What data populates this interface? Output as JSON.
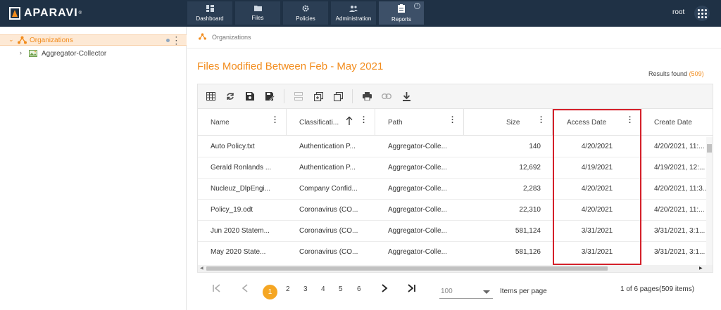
{
  "app": {
    "logo_text": "APARAVI",
    "logo_reg": "®",
    "user": "root"
  },
  "nav": {
    "tabs": [
      {
        "label": "Dashboard",
        "icon": "dashboard-icon"
      },
      {
        "label": "Files",
        "icon": "folder-icon"
      },
      {
        "label": "Policies",
        "icon": "gear-icon"
      },
      {
        "label": "Administration",
        "icon": "users-icon"
      },
      {
        "label": "Reports",
        "icon": "clipboard-icon",
        "active": true
      }
    ],
    "info_glyph": "i"
  },
  "sidebar": {
    "items": [
      {
        "label": "Organizations",
        "selected": true,
        "icon": "organization-icon"
      },
      {
        "label": "Aggregator-Collector",
        "icon": "aggregator-icon"
      }
    ]
  },
  "breadcrumb": {
    "label": "Organizations"
  },
  "report": {
    "title": "Files Modified Between Feb - May 2021",
    "results_label": "Results found",
    "results_count": "(509)"
  },
  "table": {
    "columns": [
      "Name",
      "Classificati...",
      "Path",
      "Size",
      "Access Date",
      "Create Date"
    ],
    "rows": [
      [
        "Auto Policy.txt",
        "Authentication P...",
        "Aggregator-Colle...",
        "140",
        "4/20/2021",
        "4/20/2021, 11:..."
      ],
      [
        "Gerald Ronlands ...",
        "Authentication P...",
        "Aggregator-Colle...",
        "12,692",
        "4/19/2021",
        "4/19/2021, 12:..."
      ],
      [
        "Nucleuz_DlpEngi...",
        "Company Confid...",
        "Aggregator-Colle...",
        "2,283",
        "4/20/2021",
        "4/20/2021, 11:3..."
      ],
      [
        "Policy_19.odt",
        "Coronavirus (CO...",
        "Aggregator-Colle...",
        "22,310",
        "4/20/2021",
        "4/20/2021, 11:..."
      ],
      [
        "Jun 2020 Statem...",
        "Coronavirus (CO...",
        "Aggregator-Colle...",
        "581,124",
        "3/31/2021",
        "3/31/2021, 3:1..."
      ],
      [
        "May 2020 State...",
        "Coronavirus (CO...",
        "Aggregator-Colle...",
        "581,126",
        "3/31/2021",
        "3/31/2021, 3:1..."
      ]
    ]
  },
  "pagination": {
    "pages": [
      "1",
      "2",
      "3",
      "4",
      "5",
      "6"
    ],
    "current": "1",
    "items_per_page": "100",
    "items_per_page_label": "Items per page",
    "info": "1 of 6 pages(509 items)"
  },
  "colors": {
    "topbar": "#1f3145",
    "accent": "#f28c1d",
    "highlight": "#d4202a",
    "page_current": "#f5a623"
  }
}
